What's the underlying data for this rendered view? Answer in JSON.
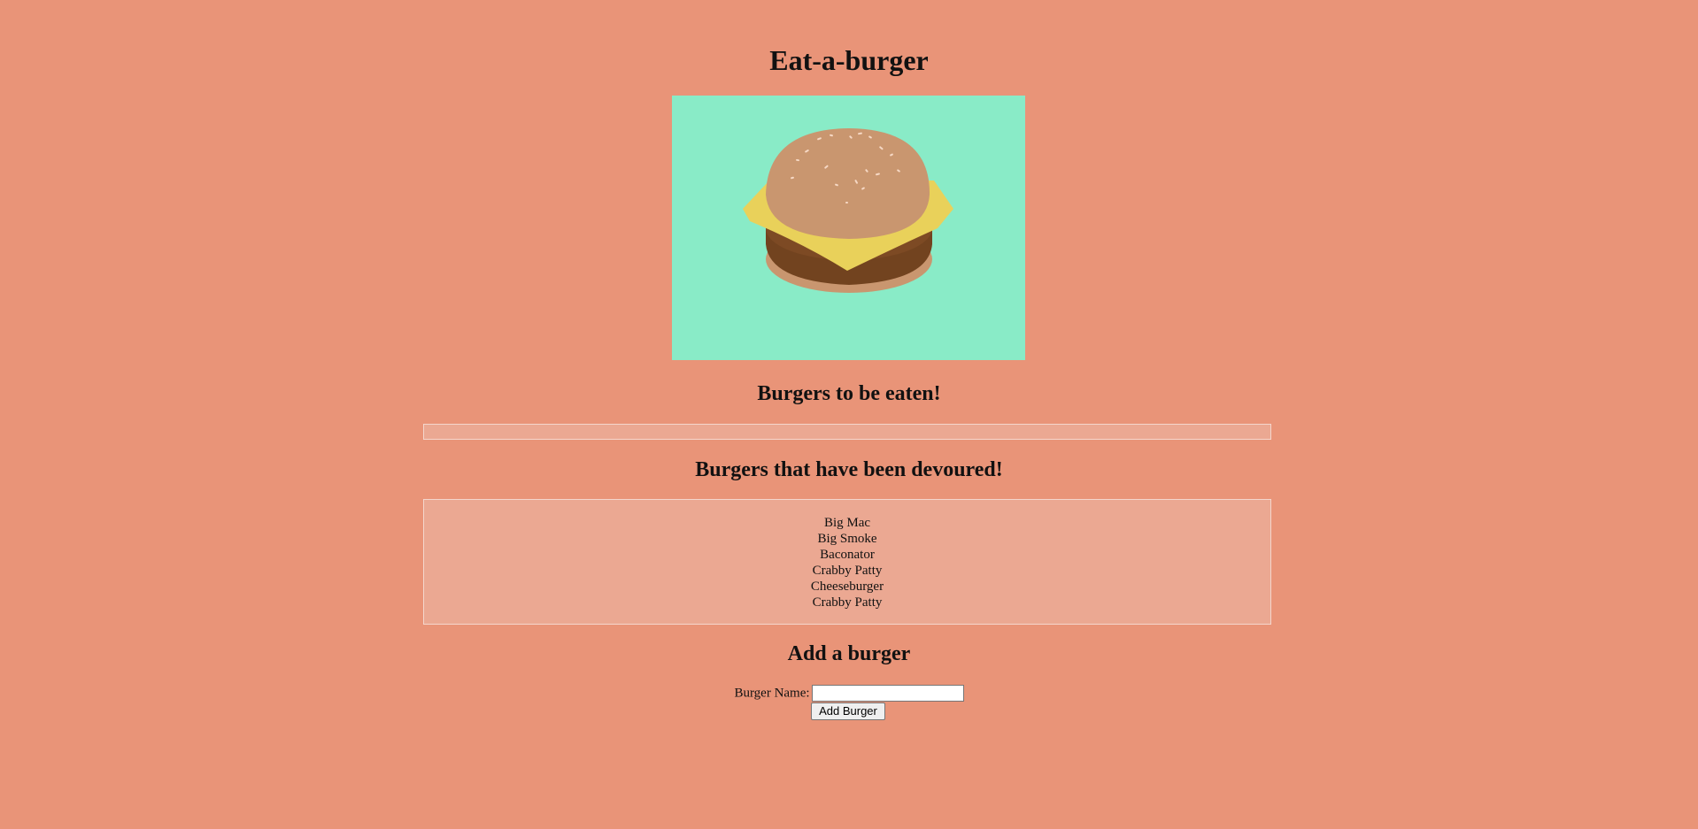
{
  "page": {
    "title": "Eat-a-burger",
    "background_color": "#e99478"
  },
  "hero_image": {
    "icon": "burger-illustration",
    "background_color": "#89ebc7"
  },
  "uneaten": {
    "heading": "Burgers to be eaten!",
    "items": []
  },
  "devoured": {
    "heading": "Burgers that have been devoured!",
    "items": [
      "Big Mac",
      "Big Smoke",
      "Baconator",
      "Crabby Patty",
      "Cheeseburger",
      "Crabby Patty"
    ]
  },
  "add_form": {
    "heading": "Add a burger",
    "name_label": "Burger Name:",
    "name_value": "",
    "name_placeholder": "",
    "submit_label": "Add Burger"
  }
}
